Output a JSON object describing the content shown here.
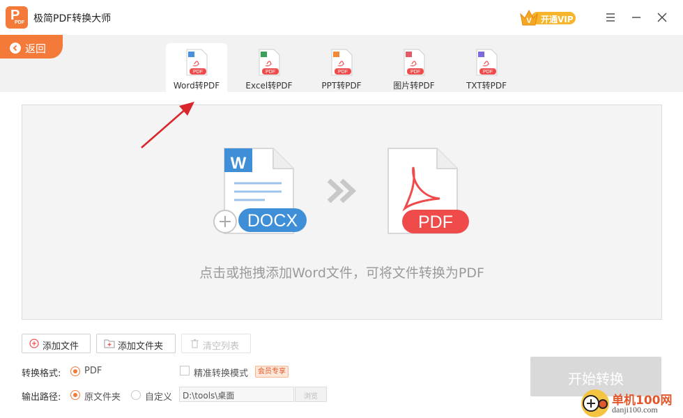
{
  "app": {
    "title": "极简PDF转换大师",
    "logo_letter": "P",
    "logo_sub": "PDF"
  },
  "vip": {
    "label": "开通VIP"
  },
  "window": {
    "menu_icon": "hamburger-icon",
    "minimize_icon": "minimize-icon",
    "close_icon": "close-icon"
  },
  "nav": {
    "back_label": "返回"
  },
  "tabs": [
    {
      "label": "Word转PDF",
      "active": true,
      "badge": "PDF",
      "color": "#4a8fdc"
    },
    {
      "label": "Excel转PDF",
      "active": false,
      "badge": "PDF",
      "color": "#3aa05a"
    },
    {
      "label": "PPT转PDF",
      "active": false,
      "badge": "PDF",
      "color": "#f0883a"
    },
    {
      "label": "图片转PDF",
      "active": false,
      "badge": "PDF",
      "color": "#e05a6a"
    },
    {
      "label": "TXT转PDF",
      "active": false,
      "badge": "PDF",
      "color": "#7a6adc"
    }
  ],
  "dropzone": {
    "hint": "点击或拖拽添加Word文件，可将文件转换为PDF",
    "source_badge": "DOCX",
    "source_letter": "W",
    "target_badge": "PDF"
  },
  "actions": {
    "add_file": "添加文件",
    "add_folder": "添加文件夹",
    "clear_list": "清空列表"
  },
  "format": {
    "label": "转换格式:",
    "option": "PDF",
    "precise_mode": "精准转换模式",
    "member_badge": "会员专享"
  },
  "output": {
    "label": "输出路径:",
    "option_original": "原文件夹",
    "option_custom": "自定义",
    "path_value": "D:\\tools\\桌面",
    "browse_label": "浏览"
  },
  "start": {
    "label": "开始转换"
  },
  "watermark": {
    "site_cn": "单机100网",
    "site_url": "danji100.com"
  },
  "colors": {
    "accent": "#f47a3a",
    "vip": "#f7b52c",
    "docx": "#3e8fd8",
    "pdf": "#f04b4b",
    "arrow": "#d9262c"
  }
}
